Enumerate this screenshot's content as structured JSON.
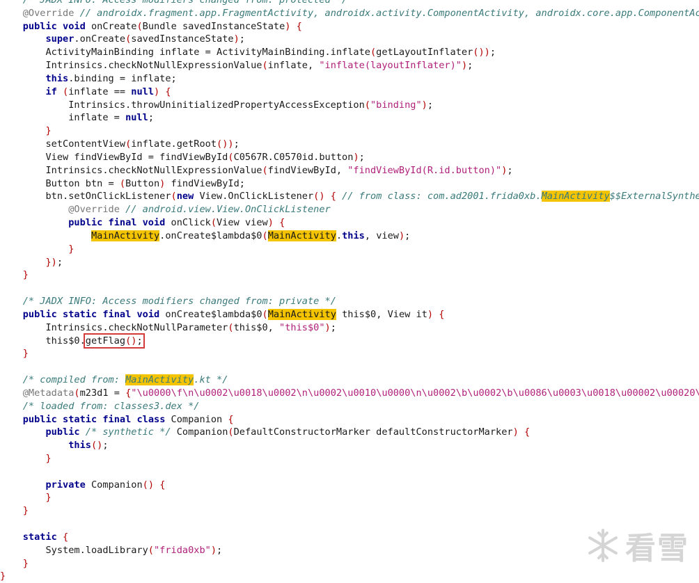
{
  "editor": {
    "lines": [
      "    /* JADX INFO: Access modifiers changed from: protected */",
      "    @Override // androidx.fragment.app.FragmentActivity, androidx.activity.ComponentActivity, androidx.core.app.ComponentAct",
      "    public void onCreate(Bundle savedInstanceState) {",
      "        super.onCreate(savedInstanceState);",
      "        ActivityMainBinding inflate = ActivityMainBinding.inflate(getLayoutInflater());",
      "        Intrinsics.checkNotNullExpressionValue(inflate, \"inflate(layoutInflater)\");",
      "        this.binding = inflate;",
      "        if (inflate == null) {",
      "            Intrinsics.throwUninitializedPropertyAccessException(\"binding\");",
      "            inflate = null;",
      "        }",
      "        setContentView(inflate.getRoot());",
      "        View findViewById = findViewById(C0567R.C0570id.button);",
      "        Intrinsics.checkNotNullExpressionValue(findViewById, \"findViewById(R.id.button)\");",
      "        Button btn = (Button) findViewById;",
      "        btn.setOnClickListener(new View.OnClickListener() { // from class: com.ad2001.frida0xb.MainActivity$$ExternalSynthet",
      "            @Override // android.view.View.OnClickListener",
      "            public final void onClick(View view) {",
      "                MainActivity.onCreate$lambda$0(MainActivity.this, view);",
      "            }",
      "        });",
      "    }",
      "",
      "    /* JADX INFO: Access modifiers changed from: private */",
      "    public static final void onCreate$lambda$0(MainActivity this$0, View it) {",
      "        Intrinsics.checkNotNullParameter(this$0, \"this$0\");",
      "        this$0.getFlag();",
      "    }",
      "",
      "    /* compiled from: MainActivity.kt */",
      "    @Metadata(m23d1 = {\"\\u0000\\f\\n\\u0002\\u0018\\u0002\\n\\u0002\\u0010\\u0000\\n\\u0002\\b\\u0002\\b\\u0086\\u0003\\u0018\\u00002\\u00020\\u",
      "    /* loaded from: classes3.dex */",
      "    public static final class Companion {",
      "        public /* synthetic */ Companion(DefaultConstructorMarker defaultConstructorMarker) {",
      "            this();",
      "        }",
      "",
      "        private Companion() {",
      "        }",
      "    }",
      "",
      "    static {",
      "        System.loadLibrary(\"frida0xb\");",
      "    }",
      "}"
    ],
    "search_highlight": "MainActivity",
    "boxed_call": "getFlag()"
  },
  "watermark": {
    "text": "看雪",
    "icon": "snowflake-icon"
  }
}
